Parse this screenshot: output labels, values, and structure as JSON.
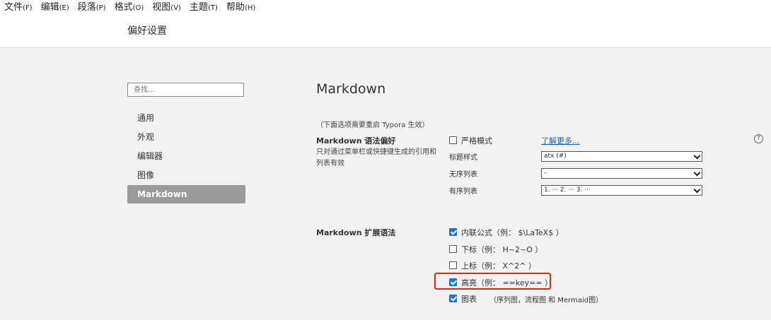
{
  "menubar": {
    "items": [
      {
        "label": "文件",
        "accel": "(F)"
      },
      {
        "label": "编辑",
        "accel": "(E)"
      },
      {
        "label": "段落",
        "accel": "(P)"
      },
      {
        "label": "格式",
        "accel": "(O)"
      },
      {
        "label": "视图",
        "accel": "(V)"
      },
      {
        "label": "主题",
        "accel": "(T)"
      },
      {
        "label": "帮助",
        "accel": "(H)"
      }
    ]
  },
  "window": {
    "title": "偏好设置"
  },
  "search": {
    "placeholder": "查找..."
  },
  "sidebar": {
    "items": [
      {
        "label": "通用"
      },
      {
        "label": "外观"
      },
      {
        "label": "编辑器"
      },
      {
        "label": "图像"
      },
      {
        "label": "Markdown"
      }
    ],
    "active": "Markdown"
  },
  "panel": {
    "title": "Markdown",
    "note": "（下面选项需要重启 Typora 生效）",
    "syntax": {
      "title": "Markdown 语法偏好",
      "desc": "只对通过菜单栏或快捷键生成的引用和列表有效",
      "strict_label": "严格模式",
      "strict_checked": false,
      "learn_more": "了解更多...",
      "help_icon": "?",
      "heading_label": "标题样式",
      "heading_value": "atx (#)",
      "ul_label": "无序列表",
      "ul_value": "-",
      "ol_label": "有序列表",
      "ol_value": "1. ··· 2. ··· 3. ···"
    },
    "ext": {
      "title": "Markdown 扩展语法",
      "options": [
        {
          "label": "内联公式（例： $\\LaTeX$ ）",
          "checked": true
        },
        {
          "label": "下标（例： H~2~O ）",
          "checked": false
        },
        {
          "label": "上标（例： X^2^ ）",
          "checked": false
        },
        {
          "label": "高亮（例： ==key== ）",
          "checked": true
        },
        {
          "label": "图表",
          "checked": true
        }
      ],
      "diagram_note": "（序列图，流程图 和 Mermaid图）"
    }
  },
  "colors": {
    "accent": "#1a73e8",
    "highlight_box": "#e3231f",
    "active_nav": "#9a9a9a"
  }
}
